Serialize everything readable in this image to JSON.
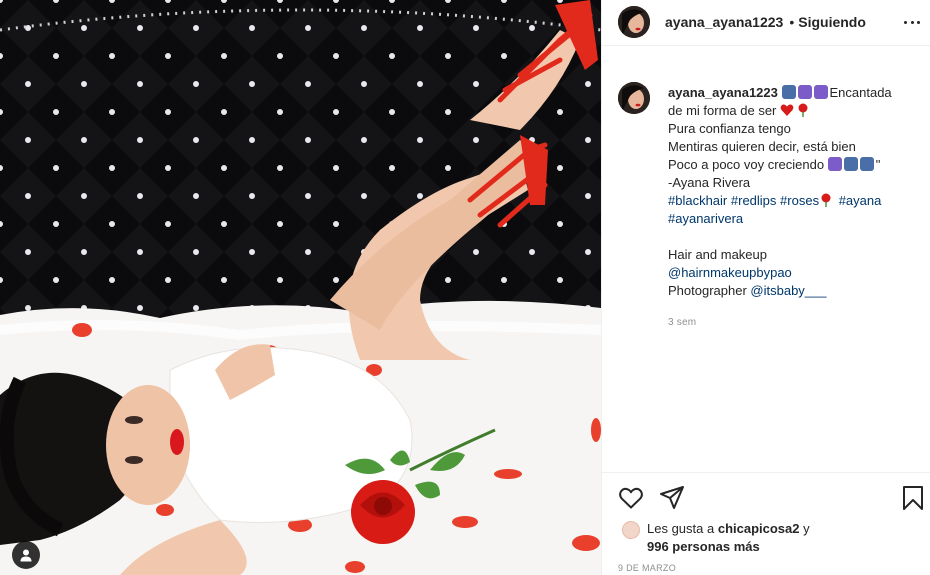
{
  "post": {
    "username": "ayana_ayana1223",
    "separator": "•",
    "follow_status": "Siguiendo"
  },
  "caption": {
    "username": "ayana_ayana1223",
    "line1_text": "Encantada",
    "line2_text": "de mi forma de ser",
    "line3": "Pura confianza tengo",
    "line4": "Mentiras quieren decir, está bien",
    "line5_text": "Poco a poco voy creciendo",
    "line5_end": "\"",
    "line6": "-Ayana Rivera",
    "hashtags": {
      "blackhair": "#blackhair",
      "redlips": "#redlips",
      "roses": "#roses",
      "ayana": "#ayana",
      "ayanarivera": "#ayanarivera"
    },
    "credits_title": "Hair and makeup",
    "mention_hair": "@hairnmakeupbypao",
    "photographer_label": "Photographer",
    "mention_photo": "@itsbaby___",
    "time": "3 sem"
  },
  "likes": {
    "prefix": "Les gusta a",
    "user": "chicapicosa2",
    "conj": "y",
    "count": "996 personas más"
  },
  "date": "9 DE MARZO",
  "icons": {
    "like": "heart-icon",
    "share": "paper-plane-icon",
    "save": "bookmark-icon",
    "more": "more-options-icon",
    "tagged": "user-tag-icon"
  },
  "colors": {
    "hashtag": "#00376b",
    "text": "#262626",
    "muted": "#8e8e8e"
  }
}
